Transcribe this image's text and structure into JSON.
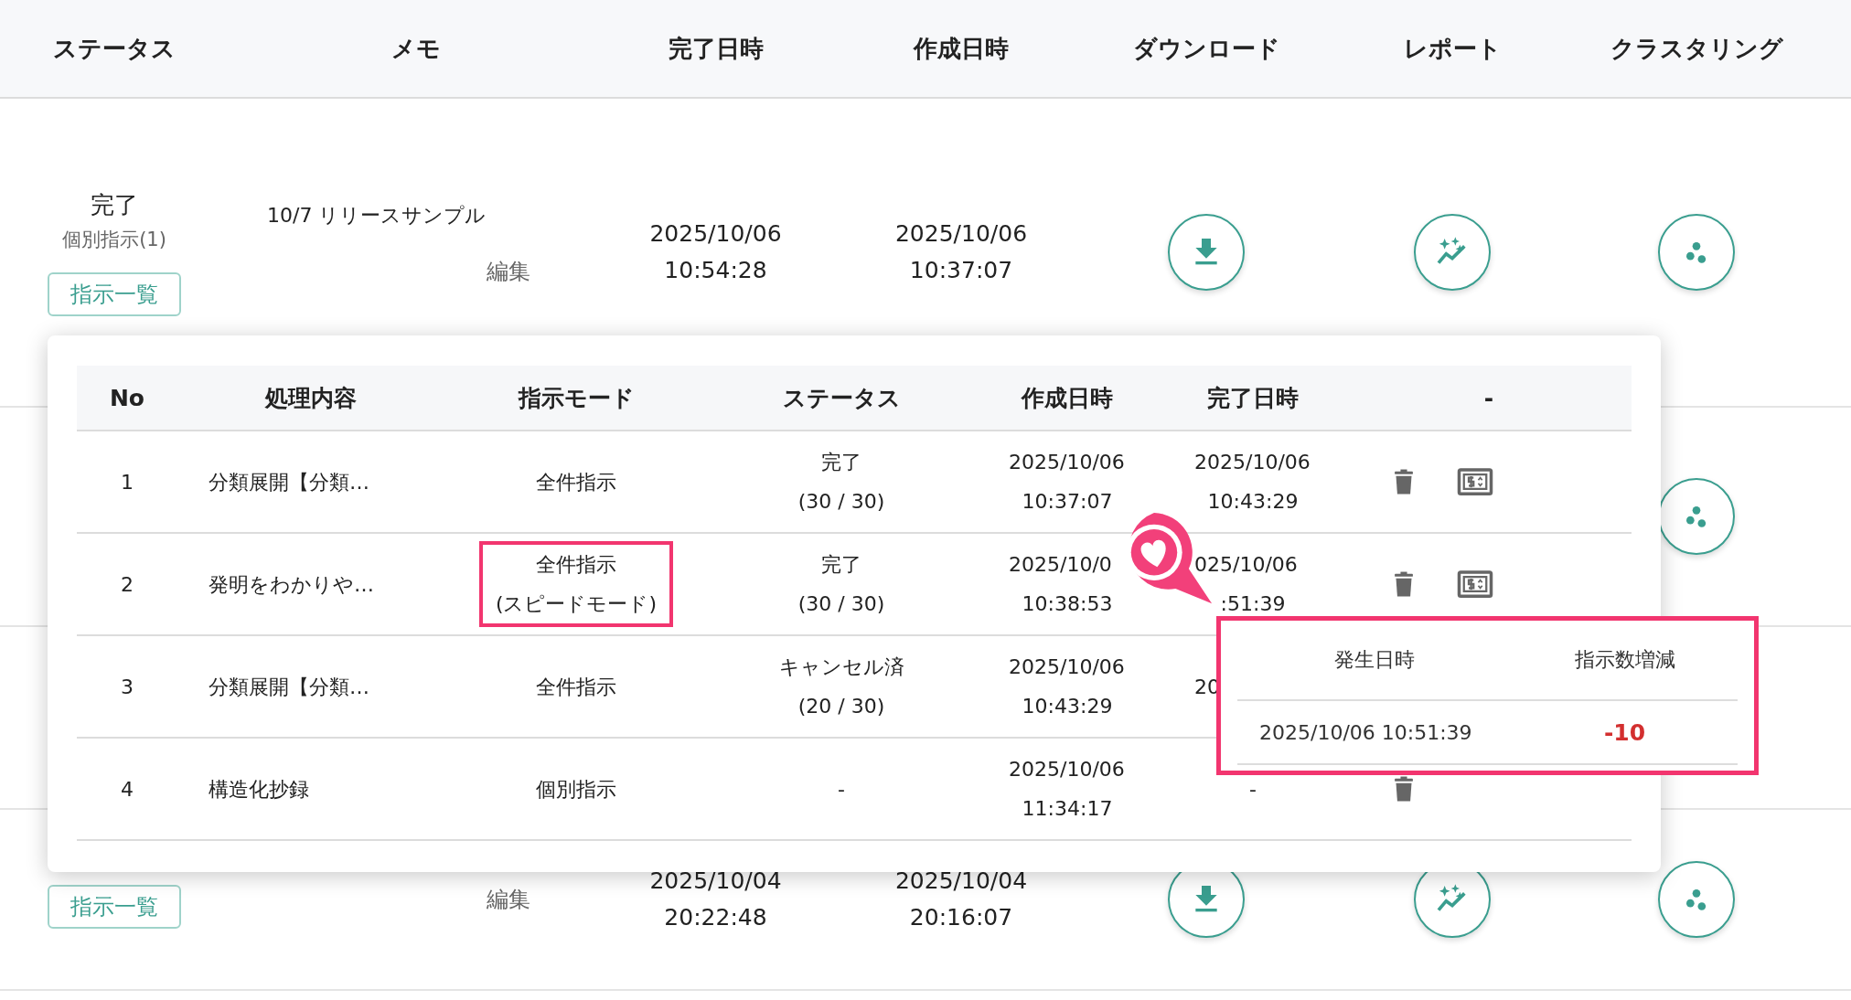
{
  "table": {
    "columns": [
      "ステータス",
      "メモ",
      "完了日時",
      "作成日時",
      "ダウンロード",
      "レポート",
      "クラスタリング"
    ],
    "rows": [
      {
        "status": "完了",
        "mode": "個別指示(1)",
        "list_button": "指示一覧",
        "memo": "10/7 リリースサンプル",
        "edit": "編集",
        "completed": [
          "2025/10/06",
          "10:54:28"
        ],
        "created": [
          "2025/10/06",
          "10:37:07"
        ],
        "download": true,
        "report": true,
        "cluster": true
      },
      {
        "download": false,
        "report": false,
        "cluster": true
      },
      {
        "download": false,
        "report": false,
        "cluster": false
      },
      {
        "list_button": "指示一覧",
        "edit": "編集",
        "completed": [
          "2025/10/04",
          "20:22:48"
        ],
        "created": [
          "2025/10/04",
          "20:16:07"
        ],
        "download": true,
        "report": true,
        "cluster": true
      }
    ]
  },
  "popover": {
    "columns": [
      "No",
      "処理内容",
      "指示モード",
      "ステータス",
      "作成日時",
      "完了日時",
      "-"
    ],
    "rows": [
      {
        "no": "1",
        "content": "分類展開【分類…",
        "mode": [
          "全件指示"
        ],
        "highlighted": false,
        "status": [
          "完了",
          "(30 / 30)"
        ],
        "created": {
          "date": "2025/10/06",
          "time": "10:37:07"
        },
        "completed": {
          "date": "2025/10/06",
          "time": "10:43:29"
        },
        "actions": [
          {
            "kind": "delete"
          },
          {
            "kind": "billing"
          }
        ]
      },
      {
        "no": "2",
        "content": "発明をわかりや…",
        "mode": [
          "全件指示",
          "(スピードモード)"
        ],
        "highlighted": true,
        "status": [
          "完了",
          "(30 / 30)"
        ],
        "created": {
          "date": "2025/10/0",
          "time": "10:38:53"
        },
        "completed": {
          "date": "025/10/06",
          "time": ":51:39"
        },
        "actions": [
          {
            "kind": "delete"
          },
          {
            "kind": "billing"
          }
        ]
      },
      {
        "no": "3",
        "content": "分類展開【分類…",
        "mode": [
          "全件指示"
        ],
        "highlighted": false,
        "status": [
          "キャンセル済",
          "(20 / 30)"
        ],
        "created": {
          "date": "2025/10/06",
          "time": "10:43:29"
        },
        "completed": {
          "date": "20"
        }
      },
      {
        "no": "4",
        "content": "構造化抄録",
        "mode": [
          "個別指示"
        ],
        "highlighted": false,
        "status": [
          "-"
        ],
        "created": {
          "date": "2025/10/06",
          "time": "11:34:17"
        },
        "completed": {
          "value": "-"
        },
        "actions": [
          {
            "kind": "delete"
          }
        ]
      }
    ]
  },
  "callout": {
    "columns": [
      "発生日時",
      "指示数増減"
    ],
    "rows": [
      {
        "datetime": "2025/10/06 10:51:39",
        "change": "-10"
      }
    ]
  }
}
